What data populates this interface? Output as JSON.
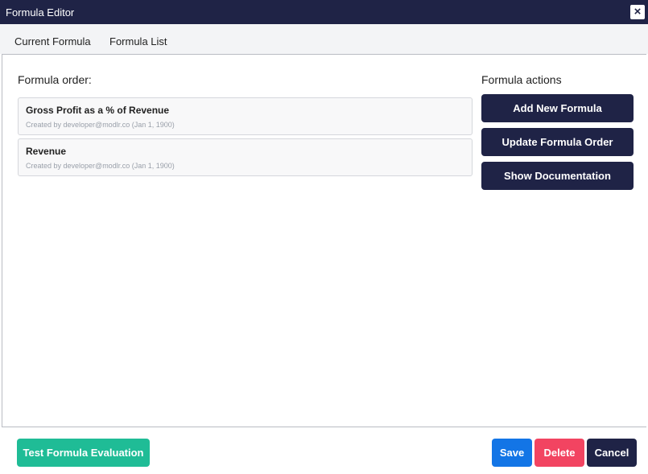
{
  "window": {
    "title": "Formula Editor",
    "close_label": "×"
  },
  "tabs": [
    {
      "label": "Current Formula"
    },
    {
      "label": "Formula List"
    }
  ],
  "order_section": {
    "heading": "Formula order:",
    "formulas": [
      {
        "name": "Gross Profit as a % of Revenue",
        "meta": "Created by developer@modlr.co (Jan 1, 1900)"
      },
      {
        "name": "Revenue",
        "meta": "Created by developer@modlr.co (Jan 1, 1900)"
      }
    ]
  },
  "actions_section": {
    "heading": "Formula actions",
    "buttons": [
      {
        "label": "Add New Formula"
      },
      {
        "label": "Update Formula Order"
      },
      {
        "label": "Show Documentation"
      }
    ]
  },
  "footer": {
    "test_label": "Test Formula Evaluation",
    "save_label": "Save",
    "delete_label": "Delete",
    "cancel_label": "Cancel"
  },
  "colors": {
    "navy": "#1f2346",
    "teal": "#1fbc96",
    "blue": "#1375e6",
    "red": "#f24461"
  },
  "icons": {
    "close": "close-icon"
  }
}
